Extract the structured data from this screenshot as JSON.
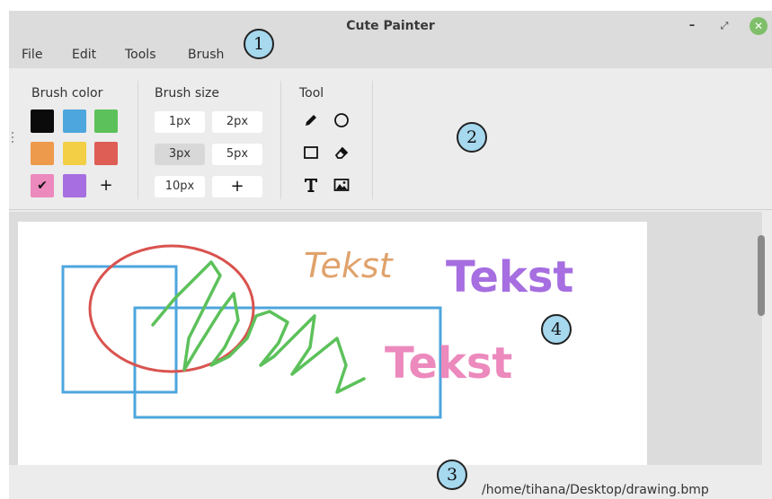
{
  "window": {
    "title": "Cute Painter"
  },
  "menu": [
    "File",
    "Edit",
    "Tools",
    "Brush"
  ],
  "toolbar": {
    "brush_color_label": "Brush color",
    "brush_size_label": "Brush size",
    "tool_label": "Tool",
    "colors": {
      "black": "#0b0b0b",
      "blue": "#4da6dd",
      "green": "#5cc15a",
      "orange": "#ee9a4c",
      "yellow": "#f2cf45",
      "red": "#de5d55",
      "pink": "#ec89bd",
      "purple": "#a66ee0"
    },
    "selected_color": "pink",
    "add_color_label": "+",
    "sizes": [
      "1px",
      "2px",
      "3px",
      "5px",
      "10px"
    ],
    "selected_size": "3px",
    "add_size_label": "+",
    "tools": [
      "pencil-icon",
      "circle-icon",
      "rectangle-icon",
      "eraser-icon",
      "text-icon",
      "image-icon"
    ],
    "selected_tool": "pencil-icon"
  },
  "canvas": {
    "texts": [
      {
        "text": "Tekst",
        "color": "#e0a26b",
        "style": "italic"
      },
      {
        "text": "Tekst",
        "color": "#a66ee0",
        "style": "bold"
      },
      {
        "text": "Tekst",
        "color": "#ec89bd",
        "style": "bold"
      }
    ],
    "stroke_colors": {
      "ellipse": "#d9534f",
      "rectangles": "#4da6dd",
      "zigzag": "#5cc15a"
    }
  },
  "status": {
    "path": "/home/tihana/Desktop/drawing.bmp"
  },
  "callouts": [
    "1",
    "2",
    "3",
    "4"
  ]
}
